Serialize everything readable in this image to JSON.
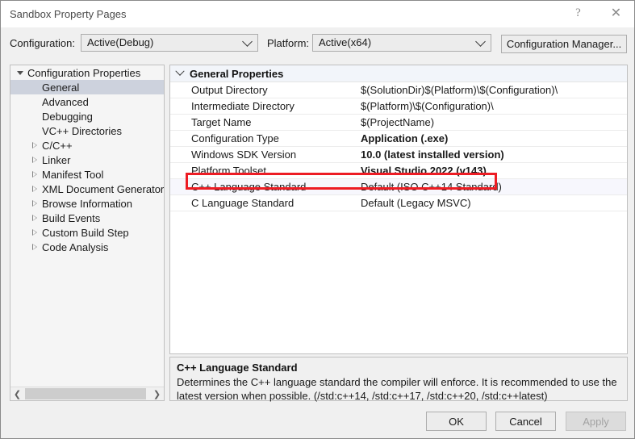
{
  "window": {
    "title": "Sandbox Property Pages",
    "help_icon": "question-mark-icon",
    "close_icon": "close-icon"
  },
  "toolbar": {
    "configuration_label": "Configuration:",
    "configuration_value": "Active(Debug)",
    "platform_label": "Platform:",
    "platform_value": "Active(x64)",
    "configuration_manager_label": "Configuration Manager..."
  },
  "tree": {
    "items": [
      {
        "label": "Configuration Properties",
        "indent": 0,
        "twisty": "expanded",
        "selected": false
      },
      {
        "label": "General",
        "indent": 1,
        "twisty": "none",
        "selected": true
      },
      {
        "label": "Advanced",
        "indent": 1,
        "twisty": "none",
        "selected": false
      },
      {
        "label": "Debugging",
        "indent": 1,
        "twisty": "none",
        "selected": false
      },
      {
        "label": "VC++ Directories",
        "indent": 1,
        "twisty": "none",
        "selected": false
      },
      {
        "label": "C/C++",
        "indent": 1,
        "twisty": "collapsed",
        "selected": false
      },
      {
        "label": "Linker",
        "indent": 1,
        "twisty": "collapsed",
        "selected": false
      },
      {
        "label": "Manifest Tool",
        "indent": 1,
        "twisty": "collapsed",
        "selected": false
      },
      {
        "label": "XML Document Generator",
        "indent": 1,
        "twisty": "collapsed",
        "selected": false
      },
      {
        "label": "Browse Information",
        "indent": 1,
        "twisty": "collapsed",
        "selected": false
      },
      {
        "label": "Build Events",
        "indent": 1,
        "twisty": "collapsed",
        "selected": false
      },
      {
        "label": "Custom Build Step",
        "indent": 1,
        "twisty": "collapsed",
        "selected": false
      },
      {
        "label": "Code Analysis",
        "indent": 1,
        "twisty": "collapsed",
        "selected": false
      }
    ],
    "scrollbar": {
      "left_arrow": "chevron-left-icon",
      "right_arrow": "chevron-right-icon"
    }
  },
  "grid": {
    "group_title": "General Properties",
    "group_state": "expanded",
    "rows": [
      {
        "name": "Output Directory",
        "value": "$(SolutionDir)$(Platform)\\$(Configuration)\\",
        "bold": false,
        "selected": false
      },
      {
        "name": "Intermediate Directory",
        "value": "$(Platform)\\$(Configuration)\\",
        "bold": false,
        "selected": false
      },
      {
        "name": "Target Name",
        "value": "$(ProjectName)",
        "bold": false,
        "selected": false
      },
      {
        "name": "Configuration Type",
        "value": "Application (.exe)",
        "bold": true,
        "selected": false
      },
      {
        "name": "Windows SDK Version",
        "value": "10.0 (latest installed version)",
        "bold": true,
        "selected": false
      },
      {
        "name": "Platform Toolset",
        "value": "Visual Studio 2022 (v143)",
        "bold": true,
        "selected": false
      },
      {
        "name": "C++ Language Standard",
        "value": "Default (ISO C++14 Standard)",
        "bold": false,
        "selected": true
      },
      {
        "name": "C Language Standard",
        "value": "Default (Legacy MSVC)",
        "bold": false,
        "selected": false
      }
    ],
    "highlight_color": "#ed1c24"
  },
  "description": {
    "title": "C++ Language Standard",
    "body": "Determines the C++ language standard the compiler will enforce. It is recommended to use the latest version when possible.  (/std:c++14, /std:c++17, /std:c++20, /std:c++latest)"
  },
  "footer": {
    "ok_label": "OK",
    "cancel_label": "Cancel",
    "apply_label": "Apply",
    "apply_enabled": false
  }
}
